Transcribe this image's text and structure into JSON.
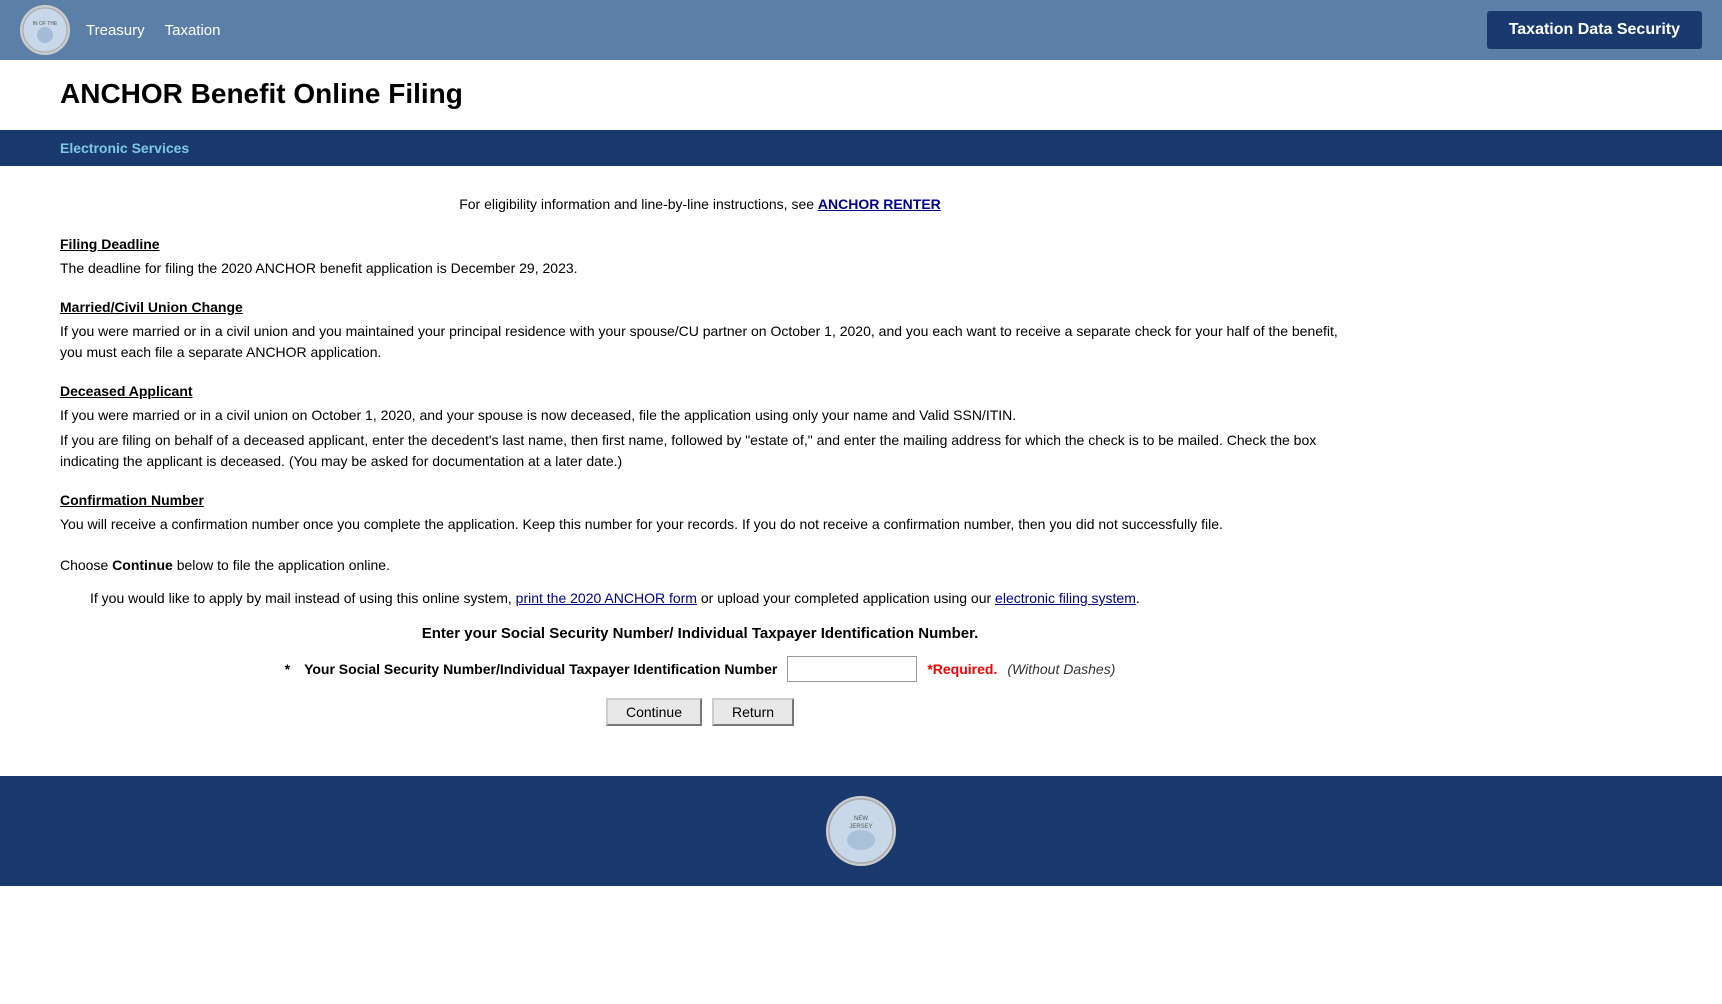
{
  "nav": {
    "treasury_label": "Treasury",
    "taxation_label": "Taxation",
    "security_button_label": "Taxation Data Security"
  },
  "page": {
    "title": "ANCHOR Benefit Online Filing",
    "electronic_services_label": "Electronic Services"
  },
  "eligibility": {
    "text": "For eligibility information and line-by-line instructions, see",
    "link_text": "ANCHOR RENTER"
  },
  "sections": [
    {
      "heading": "Filing Deadline",
      "paragraphs": [
        "The deadline for filing the 2020 ANCHOR benefit application is December 29, 2023."
      ]
    },
    {
      "heading": "Married/Civil Union Change",
      "paragraphs": [
        "If you were married or in a civil union and you maintained your principal residence with your spouse/CU partner on October 1, 2020, and you each want to receive a separate check for your half of the benefit, you must each file a separate ANCHOR application."
      ]
    },
    {
      "heading": "Deceased Applicant",
      "paragraphs": [
        "If you were married or in a civil union on October 1, 2020, and your spouse is now deceased, file the application using only your name and Valid SSN/ITIN.",
        "If you are filing on behalf of a deceased applicant, enter the decedent's last name, then first name, followed by \"estate of,\" and enter the mailing address for which the check is to be mailed. Check the box indicating the applicant is deceased. (You may be asked for documentation at a later date.)"
      ]
    },
    {
      "heading": "Confirmation Number",
      "paragraphs": [
        "You will receive a confirmation number once you complete the application. Keep this number for your records. If you do not receive a confirmation number, then you did not successfully file."
      ]
    }
  ],
  "continue_text": {
    "prefix": "Choose",
    "bold_word": "Continue",
    "suffix": "below to file the application online."
  },
  "mail_option": {
    "prefix": "If you would like to apply by mail instead of using this online system,",
    "link1_text": "print the 2020 ANCHOR form",
    "middle": "or upload your completed application using our",
    "link2_text": "electronic filing system",
    "suffix": "."
  },
  "ssn_section": {
    "title": "Enter your Social Security Number/ Individual Taxpayer Identification Number.",
    "label": "Your Social Security Number/Individual Taxpayer Identification Number",
    "asterisk": "*",
    "required_text": "*Required.",
    "without_dashes": "(Without Dashes)"
  },
  "buttons": {
    "continue_label": "Continue",
    "return_label": "Return"
  }
}
